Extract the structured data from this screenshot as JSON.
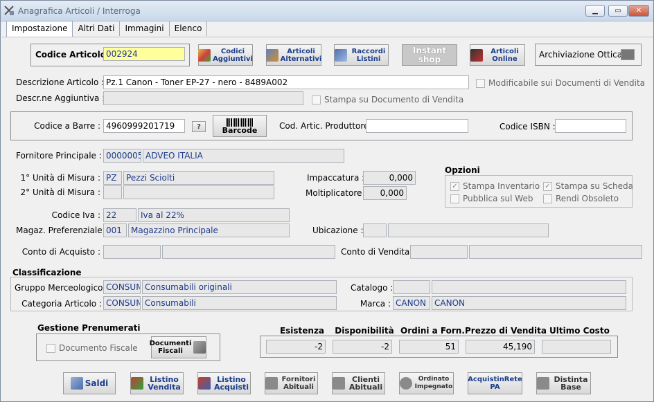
{
  "window": {
    "title": "Anagrafica Articoli / Interroga"
  },
  "tabs": [
    "Impostazione",
    "Altri Dati",
    "Immagini",
    "Elenco"
  ],
  "codice": {
    "label": "Codice Articolo :",
    "value": "002924"
  },
  "toolbar": {
    "codici": "Codici Aggiuntivi",
    "articoli_alt": "Articoli Alternativi",
    "raccordi": "Raccordi Listini",
    "instant": "Instant shop",
    "online": "Articoli Online",
    "archiviazione": "Archiviazione Ottica :"
  },
  "descrizione": {
    "label": "Descrizione Articolo :",
    "value": "Pz.1 Canon - Toner EP-27 - nero - 8489A002",
    "modificabile": "Modificabile sui Documenti di Vendita"
  },
  "descr_agg": {
    "label": "Descr.ne Aggiuntiva :",
    "value": "",
    "stampa": "Stampa su Documento di Vendita"
  },
  "barre": {
    "label": "Codice a Barre :",
    "value": "4960999201719",
    "help": "?",
    "barcode": "Barcode",
    "produttore_label": "Cod. Artic. Produttore :",
    "produttore": "",
    "isbn_label": "Codice ISBN :",
    "isbn": ""
  },
  "fornitore": {
    "label": "Fornitore Principale :",
    "code": "0000005",
    "name": "ADVEO ITALIA"
  },
  "um1": {
    "label": "1° Unità di Misura :",
    "code": "PZ",
    "name": "Pezzi Sciolti"
  },
  "um2": {
    "label": "2° Unità di Misura :",
    "code": "",
    "name": ""
  },
  "impaccatura": {
    "label": "Impaccatura :",
    "value": "0,000"
  },
  "moltiplicatore": {
    "label": "Moltiplicatore :",
    "value": "0,000"
  },
  "opzioni": {
    "title": "Opzioni",
    "inventario": "Stampa Inventario",
    "scheda": "Stampa su Scheda",
    "web": "Pubblica sul Web",
    "obsoleto": "Rendi Obsoleto"
  },
  "iva": {
    "label": "Codice Iva :",
    "code": "22",
    "name": "Iva al 22%"
  },
  "magazzino": {
    "label": "Magaz. Preferenziale :",
    "code": "001",
    "name": "Magazzino Principale"
  },
  "ubicazione": {
    "label": "Ubicazione :",
    "code": "",
    "name": ""
  },
  "conto_acq": {
    "label": "Conto di Acquisto :"
  },
  "conto_ven": {
    "label": "Conto di Vendita :"
  },
  "classificazione": {
    "title": "Classificazione",
    "gruppo_label": "Gruppo Merceologico :",
    "gruppo_code": "CONSUM",
    "gruppo": "Consumabili originali",
    "categoria_label": "Categoria Articolo :",
    "categoria_code": "CONSUM",
    "categoria": "Consumabili",
    "catalogo_label": "Catalogo :",
    "marca_label": "Marca :",
    "marca_code": "CANON",
    "marca": "CANON"
  },
  "prenumerati": {
    "title": "Gestione Prenumerati",
    "fiscale": "Documento Fiscale",
    "btn": "Documenti Fiscali"
  },
  "totali": {
    "headers": [
      "Esistenza",
      "Disponibilità",
      "Ordini a Forn.",
      "Prezzo di Vendita",
      "Ultimo Costo"
    ],
    "values": [
      "-2",
      "-2",
      "51",
      "45,190",
      ""
    ]
  },
  "bottom": [
    "Saldi",
    "Listino Vendita",
    "Listino Acquisti",
    "Fornitori Abituali",
    "Clienti Abituali",
    "Ordinato Impegnato",
    "AcquistinRete PA",
    "Distinta Base"
  ]
}
